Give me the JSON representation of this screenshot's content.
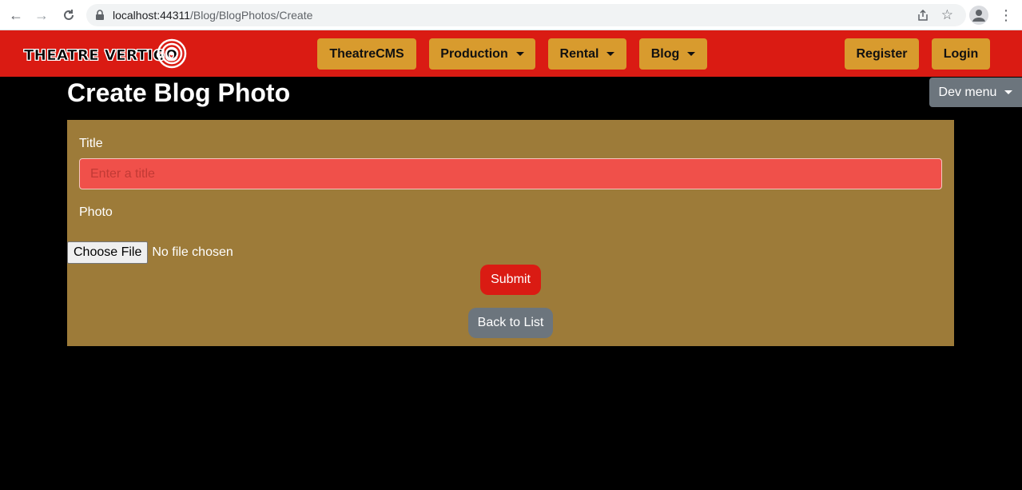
{
  "browser": {
    "url_host": "localhost:44311",
    "url_path": "/Blog/BlogPhotos/Create"
  },
  "site": {
    "logo_text": "THEATRE VERTIGO",
    "nav": {
      "theatrecms": "TheatreCMS",
      "production": "Production",
      "rental": "Rental",
      "blog": "Blog",
      "register": "Register",
      "login": "Login"
    },
    "colors": {
      "brand_red": "#da1b13",
      "nav_button": "#d89b2e",
      "panel": "#9d7b39"
    }
  },
  "page": {
    "title": "Create Blog Photo",
    "dev_menu": "Dev menu"
  },
  "form": {
    "title_label": "Title",
    "title_placeholder": "Enter a title",
    "title_value": "",
    "photo_label": "Photo",
    "file_button": "Choose File",
    "file_status": "No file chosen",
    "submit": "Submit",
    "back": "Back to List"
  },
  "icons": [
    "back-arrow-icon",
    "forward-arrow-icon",
    "reload-icon",
    "lock-icon",
    "share-icon",
    "star-icon",
    "profile-icon",
    "kebab-menu-icon",
    "logo-spiral-icon",
    "caret-down-icon"
  ]
}
